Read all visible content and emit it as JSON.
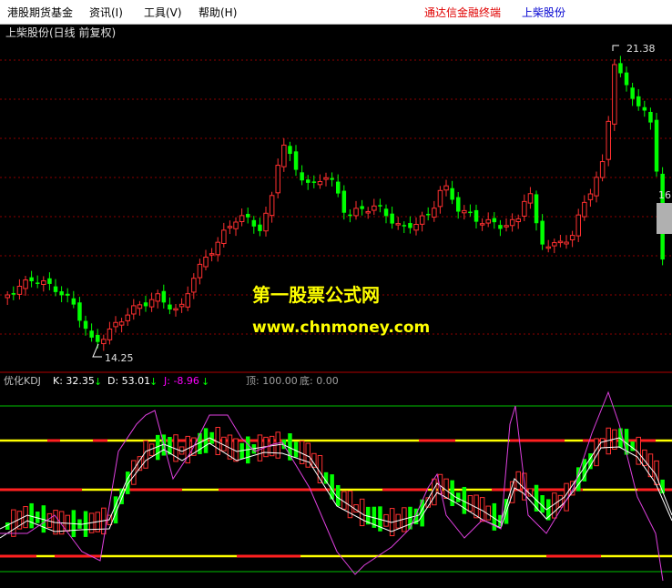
{
  "menu": {
    "items": [
      "港股期货基金",
      "资讯(I)",
      "工具(V)",
      "帮助(H)"
    ],
    "brand": "通达信金融终端",
    "stock": "上柴股份"
  },
  "main_chart": {
    "title": "上柴股份(日线 前复权)",
    "high_label": "21.38",
    "low_label": "14.25",
    "right_price": "16"
  },
  "watermark": {
    "line1": "第一股票公式网",
    "line2": "www.chnmoney.com"
  },
  "indicator": {
    "name": "优化KDJ",
    "k": "K: 32.35",
    "d": "D: 53.01",
    "j": "J: -8.96",
    "top": "顶: 100.00",
    "bottom": "底: 0.00"
  },
  "colors": {
    "up": "#ff3030",
    "down": "#00ff00",
    "k_line": "#ffffff",
    "d_line": "#ffffff",
    "j_line": "#ff00ff",
    "yellow": "#ffff00"
  },
  "chart_data": [
    {
      "type": "candlestick",
      "title": "上柴股份(日线 前复权)",
      "annotations": [
        "21.38",
        "14.25"
      ],
      "high": 21.38,
      "low": 14.25
    },
    {
      "type": "line",
      "title": "优化KDJ",
      "series": [
        {
          "name": "K",
          "last": 32.35
        },
        {
          "name": "D",
          "last": 53.01
        },
        {
          "name": "J",
          "last": -8.96
        }
      ],
      "top": 100.0,
      "bottom": 0.0
    }
  ]
}
